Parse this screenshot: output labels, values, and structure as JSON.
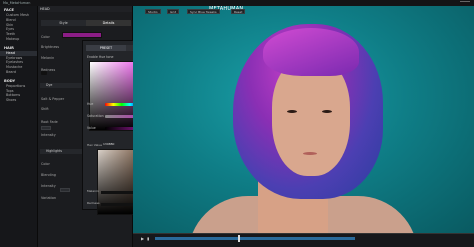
{
  "window": {
    "file_tab": "Mo_MetaHuman"
  },
  "tree": {
    "groups": [
      {
        "label": "FACE",
        "items": [
          "Custom Mesh",
          "Blend",
          "Skin",
          "Eyes",
          "Teeth",
          "Makeup"
        ]
      },
      {
        "label": "HAIR",
        "items": [
          "Head",
          "Eyebrows",
          "Eyelashes",
          "Mustache",
          "Beard"
        ]
      },
      {
        "label": "BODY",
        "items": [
          "Proportions",
          "Tops",
          "Bottoms",
          "Shoes"
        ]
      }
    ],
    "active_item": "Head"
  },
  "panel": {
    "title": "HEAD",
    "tabs": [
      "Style",
      "Details"
    ],
    "active_tab": "Details",
    "rows": {
      "color": "Color",
      "brightness": "Brightness",
      "melanin": "Melanin",
      "redness": "Redness",
      "salt_pepper": "Salt & Pepper",
      "dye": "Dye",
      "shift": "Shift",
      "root_fade": "Root Fade",
      "intensity": "Intensity",
      "highlights": "Highlights",
      "color2": "Color",
      "blending": "Blending",
      "intensity2": "Intensity",
      "variation": "Variation"
    },
    "color_hex": "#8B1D86"
  },
  "picker": {
    "tabs": [
      "PRESET",
      "CUSTOM"
    ],
    "active_tab": "PRESET",
    "checkbox_label": "Enable Hue tone",
    "hue_label": "Hue",
    "saturation_label": "Saturation",
    "value_label": "Value",
    "hex_label": "Hex Value",
    "hex_value": "139880",
    "melanin_label": "Melanin",
    "redness_label": "Redness"
  },
  "viewport": {
    "title": "METAHUMAN",
    "tools": [
      "Studio",
      "Grid",
      "Sync Blue Tweaks",
      "Reset"
    ],
    "background": "#0f7e87"
  },
  "colors": {
    "accent": "#8b1d86",
    "hair_primary": "#c13ec6",
    "hair_secondary": "#2a3d9e"
  }
}
